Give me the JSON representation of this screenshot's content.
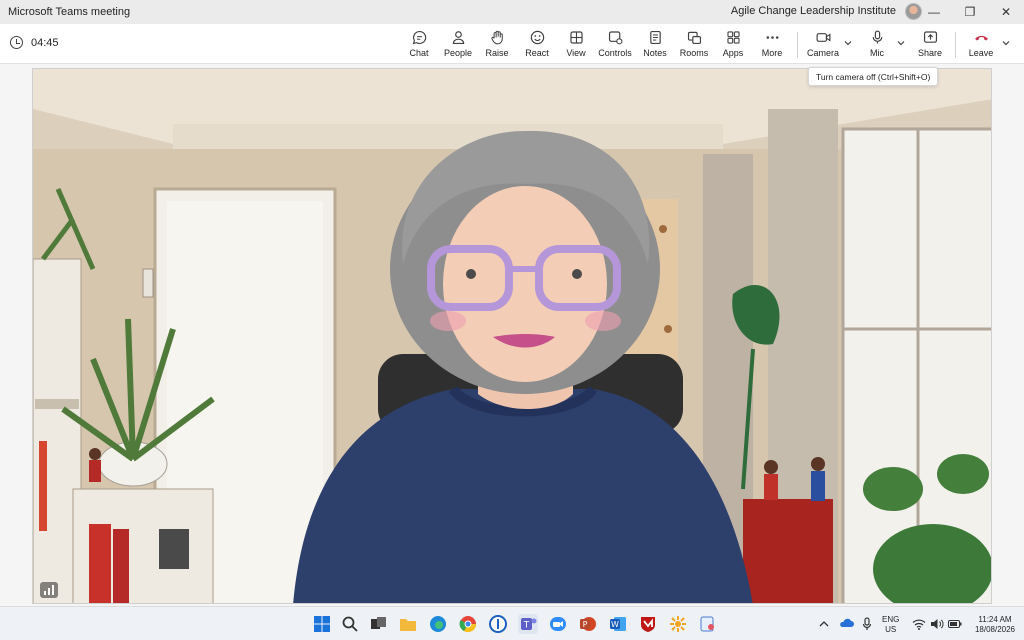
{
  "window": {
    "title": "Microsoft Teams meeting",
    "organization": "Agile Change Leadership Institute"
  },
  "toolbar": {
    "timer": "04:45",
    "buttons": [
      {
        "label": "Chat"
      },
      {
        "label": "People"
      },
      {
        "label": "Raise"
      },
      {
        "label": "React"
      },
      {
        "label": "View"
      },
      {
        "label": "Controls"
      },
      {
        "label": "Notes"
      },
      {
        "label": "Rooms"
      },
      {
        "label": "Apps"
      },
      {
        "label": "More"
      }
    ],
    "camera": "Camera",
    "mic": "Mic",
    "share": "Share",
    "leave": "Leave",
    "leave_color": "#c4314b"
  },
  "tooltip": {
    "text": "Turn camera off (Ctrl+Shift+O)"
  },
  "taskbar": {
    "language": "ENG",
    "region": "US",
    "time": "11:24 AM",
    "date": "18/08/2026"
  }
}
